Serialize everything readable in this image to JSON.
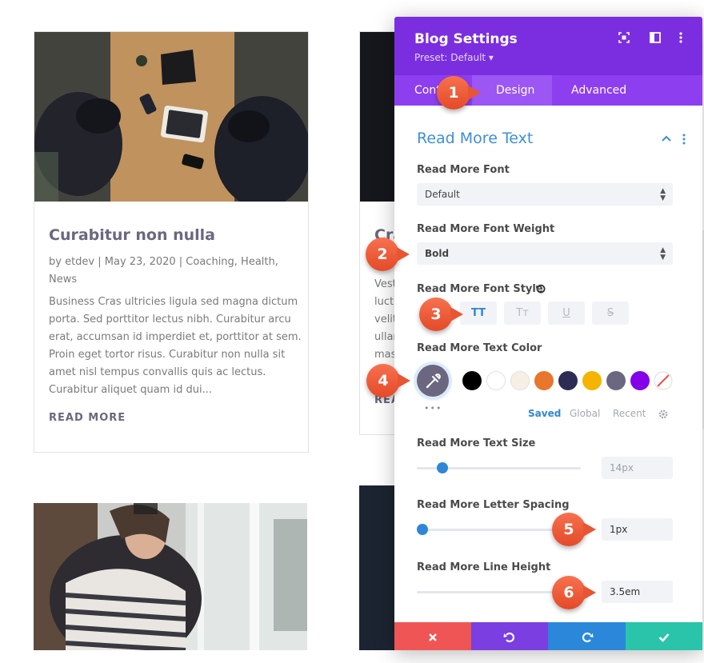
{
  "blog": {
    "card1": {
      "title": "Curabitur non nulla",
      "meta_line1": "by etdev | May 23, 2020 | Coaching, Health,",
      "meta_line2": "News",
      "excerpt": [
        "Business Cras ultricies ligula sed magna dictum",
        "porta. Sed porttitor lectus nibh. Curabitur arcu",
        "erat, accumsan id imperdiet et, porttitor at sem.",
        "Proin eget tortor risus. Curabitur non nulla sit",
        "amet nisl tempus convallis quis ac lectus.",
        "Curabitur aliquet quam id dui..."
      ],
      "read_more": "READ MORE"
    },
    "card2": {
      "title_partial": "Cra",
      "excerpt_partial": [
        "Vest",
        "luctu",
        "velit",
        "ullan",
        "mas"
      ],
      "read_more_partial": "REA"
    }
  },
  "panel": {
    "title": "Blog Settings",
    "preset": "Preset: Default ▾",
    "tabs": [
      "Cont",
      "Design",
      "Advanced"
    ],
    "active_tab": "Design",
    "section_title": "Read More Text",
    "font_label": "Read More Font",
    "font_value": "Default",
    "weight_label": "Read More Font Weight",
    "weight_value": "Bold",
    "style_label": "Read More Font Style",
    "style_buttons": [
      "TT",
      "Tт",
      "U",
      "S"
    ],
    "color_label": "Read More Text Color",
    "picker_color": "#6b6780",
    "swatches": [
      "#000000",
      "#ffffff",
      "#f5efe6",
      "#e8762c",
      "#2c2c54",
      "#f4b400",
      "#6b6780",
      "#8300e9"
    ],
    "palette_tabs": [
      "Saved",
      "Global",
      "Recent"
    ],
    "palette_more": "•••",
    "size_label": "Read More Text Size",
    "size_value": "14px",
    "size_level": 0.12,
    "spacing_label": "Read More Letter Spacing",
    "spacing_value": "1px",
    "spacing_level": 0.0,
    "lineheight_label": "Read More Line Height",
    "lineheight_value": "3.5em",
    "footer": {
      "cancel_color": "#ef5555",
      "undo_color": "#7b3ee0",
      "redo_color": "#2b87da",
      "save_color": "#29c4a9"
    }
  },
  "callouts": [
    "1",
    "2",
    "3",
    "4",
    "5",
    "6"
  ],
  "accent_color": "#2f86d6",
  "brand_color": "#7b2ee0"
}
